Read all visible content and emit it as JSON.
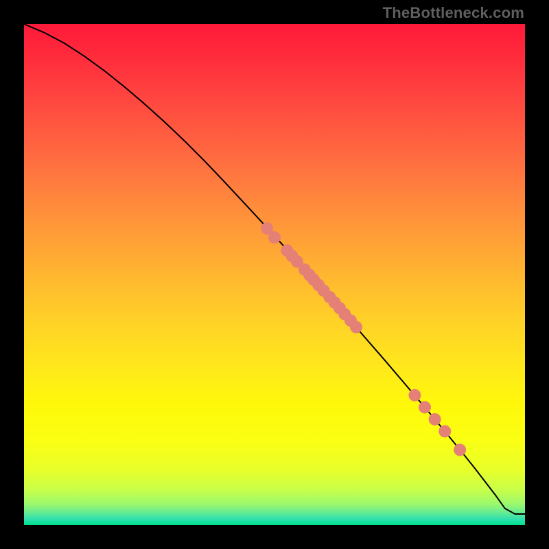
{
  "watermark": "TheBottleneck.com",
  "gradient_stops": [
    {
      "offset": 0.0,
      "color": "#ff1a3a"
    },
    {
      "offset": 0.06,
      "color": "#ff2a3b"
    },
    {
      "offset": 0.13,
      "color": "#ff4040"
    },
    {
      "offset": 0.2,
      "color": "#ff5640"
    },
    {
      "offset": 0.28,
      "color": "#ff7040"
    },
    {
      "offset": 0.36,
      "color": "#ff8a3c"
    },
    {
      "offset": 0.44,
      "color": "#ffa336"
    },
    {
      "offset": 0.52,
      "color": "#ffbc2e"
    },
    {
      "offset": 0.6,
      "color": "#ffd326"
    },
    {
      "offset": 0.68,
      "color": "#ffe71c"
    },
    {
      "offset": 0.76,
      "color": "#fff80a"
    },
    {
      "offset": 0.83,
      "color": "#fbff13"
    },
    {
      "offset": 0.89,
      "color": "#e8ff2a"
    },
    {
      "offset": 0.93,
      "color": "#c8ff4a"
    },
    {
      "offset": 0.958,
      "color": "#9cf86c"
    },
    {
      "offset": 0.975,
      "color": "#66ec92"
    },
    {
      "offset": 0.987,
      "color": "#34e0ad"
    },
    {
      "offset": 0.995,
      "color": "#12e0a0"
    },
    {
      "offset": 1.0,
      "color": "#00df88"
    }
  ],
  "chart_data": {
    "type": "line",
    "title": "",
    "xlabel": "",
    "ylabel": "",
    "xlim": [
      0,
      100
    ],
    "ylim": [
      0,
      100
    ],
    "series": [
      {
        "name": "curve",
        "x": [
          0,
          4,
          8,
          12,
          16,
          20,
          24,
          28,
          32,
          36,
          40,
          44,
          48,
          52,
          56,
          60,
          64,
          68,
          72,
          76,
          80,
          84,
          88,
          90,
          92,
          94,
          96,
          98,
          100
        ],
        "y": [
          100,
          98.3,
          96.2,
          93.6,
          90.7,
          87.5,
          84.1,
          80.5,
          76.7,
          72.7,
          68.5,
          64.2,
          59.9,
          55.5,
          51.1,
          46.6,
          42.1,
          37.5,
          32.9,
          28.2,
          23.5,
          18.7,
          13.8,
          11.3,
          8.7,
          6.1,
          3.3,
          2.2,
          2.2
        ]
      }
    ],
    "markers": {
      "color": "#e58076",
      "radius_px": 9,
      "points": [
        {
          "x": 48.5,
          "y": 59.2
        },
        {
          "x": 50.0,
          "y": 57.4
        },
        {
          "x": 52.5,
          "y": 54.8
        },
        {
          "x": 53.5,
          "y": 53.7
        },
        {
          "x": 54.5,
          "y": 52.6
        },
        {
          "x": 56.0,
          "y": 51.0
        },
        {
          "x": 57.0,
          "y": 49.9
        },
        {
          "x": 57.8,
          "y": 49.0
        },
        {
          "x": 58.8,
          "y": 47.9
        },
        {
          "x": 59.8,
          "y": 46.8
        },
        {
          "x": 61.0,
          "y": 45.5
        },
        {
          "x": 62.0,
          "y": 44.4
        },
        {
          "x": 63.0,
          "y": 43.3
        },
        {
          "x": 64.0,
          "y": 42.1
        },
        {
          "x": 65.2,
          "y": 40.8
        },
        {
          "x": 66.3,
          "y": 39.5
        },
        {
          "x": 78.0,
          "y": 25.9
        },
        {
          "x": 80.0,
          "y": 23.5
        },
        {
          "x": 82.0,
          "y": 21.1
        },
        {
          "x": 84.0,
          "y": 18.7
        },
        {
          "x": 87.0,
          "y": 15.0
        }
      ]
    }
  }
}
